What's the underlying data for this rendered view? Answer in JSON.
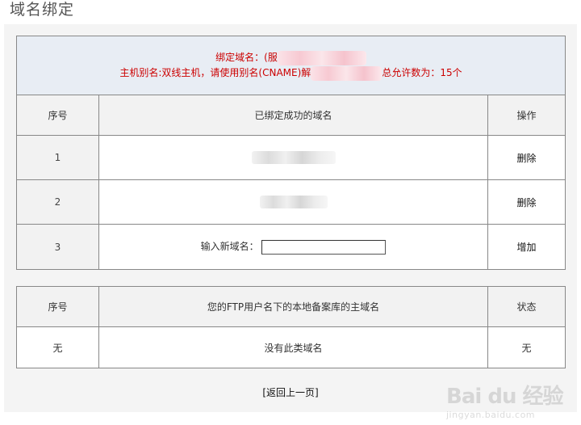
{
  "page": {
    "title": "域名绑定"
  },
  "notice": {
    "line1_prefix": "绑定域名：(服",
    "line2_prefix": "主机别名:双线主机，请使用别名(CNAME)解",
    "line2_suffix": "总允许数为：15个"
  },
  "bound_table": {
    "headers": {
      "index": "序号",
      "domain": "已绑定成功的域名",
      "action": "操作"
    },
    "rows": [
      {
        "index": "1",
        "action": "删除"
      },
      {
        "index": "2",
        "action": "删除"
      }
    ],
    "new_row": {
      "index": "3",
      "label": "输入新域名：",
      "value": "",
      "action": "增加"
    }
  },
  "ftp_table": {
    "headers": {
      "index": "序号",
      "domain": "您的FTP用户名下的本地备案库的主域名",
      "status": "状态"
    },
    "row": {
      "index": "无",
      "domain": "没有此类域名",
      "status": "无"
    }
  },
  "footer": {
    "back_label": "[返回上一页]"
  },
  "watermark": {
    "main": "Bai du 经验",
    "sub": "jingyan.baidu.com"
  },
  "colors": {
    "notice_text": "#cc0000",
    "notice_bg": "#e8edf4",
    "panel_bg": "#f4f4f4"
  }
}
